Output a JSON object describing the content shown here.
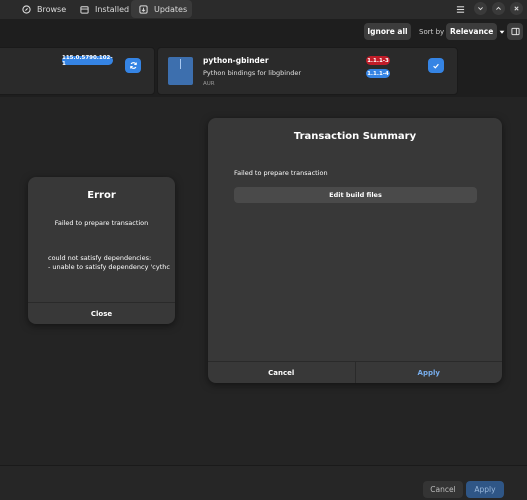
{
  "tabs": [
    {
      "label": "Browse",
      "icon": "compass-icon"
    },
    {
      "label": "Installed",
      "icon": "package-icon"
    },
    {
      "label": "Updates",
      "icon": "updates-icon"
    }
  ],
  "toolbar": {
    "ignore_all": "Ignore all",
    "sort_by_label": "Sort by",
    "sort_value": "Relevance"
  },
  "updates": {
    "card1": {
      "new_version": "115.0.5790.102-1"
    },
    "card2": {
      "name": "python-gbinder",
      "description": "Python bindings for libgbinder",
      "source": "AUR",
      "old_version": "1.1.1-3",
      "new_version": "1.1.1-4"
    }
  },
  "colors": {
    "accent": "#3584e4",
    "danger": "#c01c28",
    "apply_text": "#78aeed"
  },
  "error_dialog": {
    "title": "Error",
    "message": "Failed to prepare transaction",
    "details_line1": "could not satisfy dependencies:",
    "details_line2": "- unable to satisfy dependency 'cythc",
    "close": "Close"
  },
  "summary_dialog": {
    "title": "Transaction Summary",
    "message": "Failed to prepare transaction",
    "edit_build_files": "Edit build files",
    "cancel": "Cancel",
    "apply": "Apply"
  },
  "bottom": {
    "cancel": "Cancel",
    "apply": "Apply"
  }
}
